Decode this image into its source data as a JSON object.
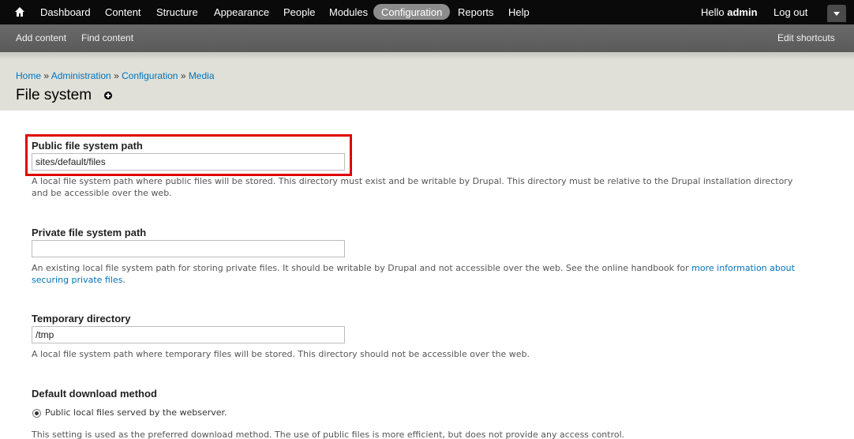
{
  "toolbar": {
    "items": [
      "Dashboard",
      "Content",
      "Structure",
      "Appearance",
      "People",
      "Modules",
      "Configuration",
      "Reports",
      "Help"
    ],
    "hello_prefix": "Hello ",
    "user": "admin",
    "logout": "Log out"
  },
  "shortcuts": {
    "add_content": "Add content",
    "find_content": "Find content",
    "edit_shortcuts": "Edit shortcuts"
  },
  "breadcrumb": {
    "items": [
      "Home",
      "Administration",
      "Configuration",
      "Media"
    ],
    "separator": " » "
  },
  "page_title": "File system",
  "form": {
    "public_path": {
      "label": "Public file system path",
      "value": "sites/default/files",
      "description": "A local file system path where public files will be stored. This directory must exist and be writable by Drupal. This directory must be relative to the Drupal installation directory and be accessible over the web."
    },
    "private_path": {
      "label": "Private file system path",
      "value": "",
      "description_prefix": "An existing local file system path for storing private files. It should be writable by Drupal and not accessible over the web. See the online handbook for ",
      "description_link": "more information about securing private files",
      "description_suffix": "."
    },
    "temp_dir": {
      "label": "Temporary directory",
      "value": "/tmp",
      "description": "A local file system path where temporary files will be stored. This directory should not be accessible over the web."
    },
    "download_method": {
      "label": "Default download method",
      "option": "Public local files served by the webserver.",
      "description": "This setting is used as the preferred download method. The use of public files is more efficient, but does not provide any access control."
    }
  },
  "colors": {
    "highlight": "#e00000",
    "link": "#0074bd",
    "toolbar_bg": "#0a0a0a"
  }
}
